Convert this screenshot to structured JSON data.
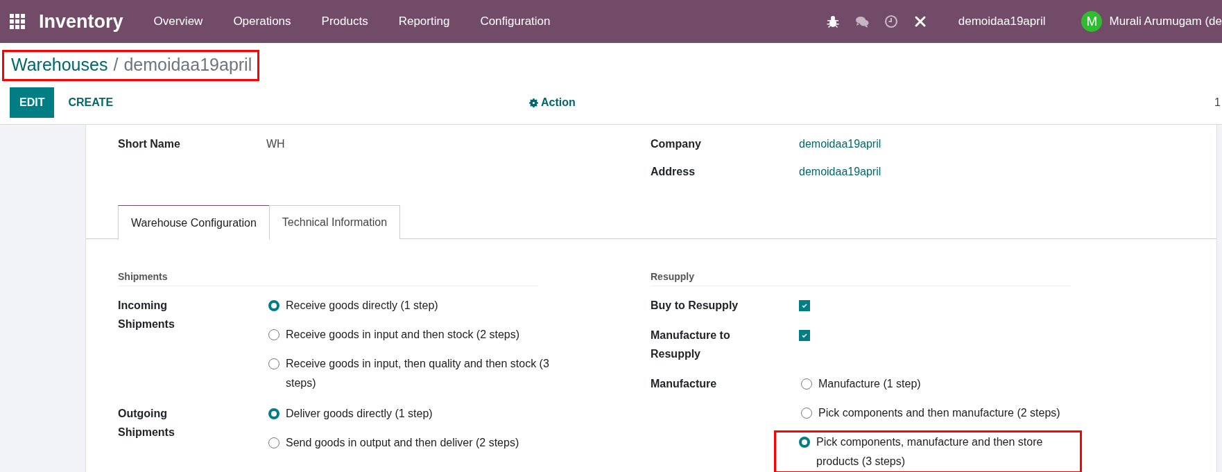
{
  "top_bar": {
    "app_name": "Inventory",
    "menu": [
      "Overview",
      "Operations",
      "Products",
      "Reporting",
      "Configuration"
    ],
    "company": "demoidaa19april",
    "user": {
      "initial": "M",
      "name": "Murali Arumugam (de"
    }
  },
  "breadcrumb": {
    "parent": "Warehouses",
    "separator": "/",
    "current": "demoidaa19april",
    "highlighted": true
  },
  "control_panel": {
    "buttons": [
      {
        "label": "EDIT",
        "kind": "primary"
      },
      {
        "label": "CREATE",
        "kind": "secondary"
      }
    ],
    "action": "Action",
    "pager": "1"
  },
  "form": {
    "left_fields": [
      {
        "label": "Short Name",
        "value": "WH",
        "kind": "text"
      }
    ],
    "right_fields": [
      {
        "label": "Company",
        "value": "demoidaa19april",
        "kind": "link"
      },
      {
        "label": "Address",
        "value": "demoidaa19april",
        "kind": "link"
      }
    ],
    "tabs": [
      {
        "label": "Warehouse Configuration",
        "selected": true
      },
      {
        "label": "Technical Information",
        "selected": false
      }
    ],
    "groups": [
      {
        "title": "Shipments",
        "fields": [
          {
            "label": "Incoming Shipments",
            "kind": "radio",
            "options": [
              {
                "label": "Receive goods directly (1 step)",
                "selected": true,
                "highlighted": false
              },
              {
                "label": "Receive goods in input and then stock (2 steps)",
                "selected": false,
                "highlighted": false
              },
              {
                "label": "Receive goods in input, then quality and then stock (3 steps)",
                "selected": false,
                "highlighted": false
              }
            ]
          },
          {
            "label": "Outgoing Shipments",
            "kind": "radio",
            "options": [
              {
                "label": "Deliver goods directly (1 step)",
                "selected": true,
                "highlighted": false
              },
              {
                "label": "Send goods in output and then deliver (2 steps)",
                "selected": false,
                "highlighted": false
              }
            ]
          }
        ]
      },
      {
        "title": "Resupply",
        "fields": [
          {
            "label": "Buy to Resupply",
            "kind": "checkbox",
            "checked": true
          },
          {
            "label": "Manufacture to Resupply",
            "kind": "checkbox",
            "checked": true
          },
          {
            "label": "Manufacture",
            "kind": "radio",
            "options": [
              {
                "label": "Manufacture (1 step)",
                "selected": false,
                "highlighted": false
              },
              {
                "label": "Pick components and then manufacture (2 steps)",
                "selected": false,
                "highlighted": false
              },
              {
                "label": "Pick components, manufacture and then store products (3 steps)",
                "selected": true,
                "highlighted": true
              }
            ]
          }
        ]
      }
    ]
  }
}
